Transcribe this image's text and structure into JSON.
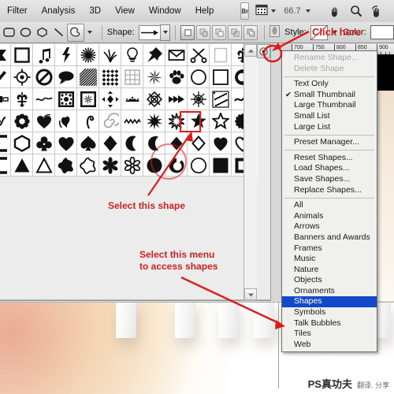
{
  "menubar": {
    "items": [
      "Filter",
      "Analysis",
      "3D",
      "View",
      "Window",
      "Help"
    ],
    "bridge_label": "Br",
    "zoom_value": "66.7",
    "icons": [
      "bridge-icon",
      "view-extras-icon",
      "hand-tool-icon",
      "zoom-tool-icon",
      "rotate-view-icon",
      "screen-mode-icon"
    ]
  },
  "options_bar": {
    "shape_label": "Shape:",
    "style_label": "Style:",
    "color_label": "Color:",
    "color_value": "#ffffff",
    "tools": [
      "rounded-rectangle-tool",
      "ellipse-tool",
      "polygon-tool",
      "line-tool",
      "custom-shape-tool"
    ],
    "mode_buttons": [
      "shape-layers-mode",
      "add-to-shape-area",
      "subtract-from-shape-area",
      "intersect-shape-areas",
      "exclude-overlapping-areas"
    ]
  },
  "ruler": {
    "labels": [
      "700",
      "750",
      "800",
      "850",
      "900"
    ]
  },
  "shape_picker": {
    "rows": [
      [
        "flag-banner",
        "square-frame",
        "eighth-notes",
        "lightning-bolt",
        "starburst-spiky",
        "grass-tuft",
        "light-bulb",
        "push-pin",
        "envelope",
        "scissors",
        "blank-photo",
        "fleur-de-lis"
      ],
      [
        "brush-stroke",
        "target-crosshair",
        "no-entry-sign",
        "speech-bubble",
        "diagonal-hatch",
        "dot-grid-diamonds",
        "square-grid",
        "star-burst-8",
        "paw-print",
        "circle-outline",
        "square-outline",
        "copyright-c"
      ],
      [
        "rectangle-tab",
        "fleur-de-lis-2",
        "flourish-swirl",
        "ornate-tile-square",
        "ornate-tile-square-2",
        "four-way-arrow-diamond",
        "crown-ornament",
        "diamond-knot",
        "arrow-feather",
        "snowflake-ornate",
        "damask-tile",
        "double-swirl"
      ],
      [
        "ribbon-knot",
        "flower-rosette",
        "heart-vine",
        "heart-leaf-swirl",
        "curled-vine",
        "spiral",
        "zigzag-line",
        "star-burst-10",
        "star-burst-jagged",
        "star-5-filled",
        "star-5-outline",
        "blob-circle"
      ],
      [
        "rounded-square-open",
        "hexagon-outline",
        "club-suit",
        "heart-suit",
        "spade-suit",
        "diamond-suit",
        "crescent-moon",
        "crescent-moon-2",
        "diamond-small",
        "diamond-outline",
        "heart-filled",
        "heart-outline"
      ],
      [
        "square-frame-open",
        "triangle-filled",
        "triangle-outline",
        "star-blob-4",
        "star-blob-outline",
        "asterisk-6",
        "flower-6-outline",
        "circle-filled",
        "circle-ring",
        "circle-outline-2",
        "square-filled",
        "square-in-square"
      ]
    ],
    "selected_shape": "star-5-filled",
    "selected_row": 3,
    "selected_col": 9
  },
  "flyout_menu": {
    "groups": [
      [
        {
          "label": "Rename Shape...",
          "state": "disabled"
        },
        {
          "label": "Delete Shape",
          "state": "disabled"
        }
      ],
      [
        {
          "label": "Text Only",
          "state": "normal"
        },
        {
          "label": "Small Thumbnail",
          "state": "checked"
        },
        {
          "label": "Large Thumbnail",
          "state": "normal"
        },
        {
          "label": "Small List",
          "state": "normal"
        },
        {
          "label": "Large List",
          "state": "normal"
        }
      ],
      [
        {
          "label": "Preset Manager...",
          "state": "normal"
        }
      ],
      [
        {
          "label": "Reset Shapes...",
          "state": "normal"
        },
        {
          "label": "Load Shapes...",
          "state": "normal"
        },
        {
          "label": "Save Shapes...",
          "state": "normal"
        },
        {
          "label": "Replace Shapes...",
          "state": "normal"
        }
      ],
      [
        {
          "label": "All",
          "state": "normal"
        },
        {
          "label": "Animals",
          "state": "normal"
        },
        {
          "label": "Arrows",
          "state": "normal"
        },
        {
          "label": "Banners and Awards",
          "state": "normal"
        },
        {
          "label": "Frames",
          "state": "normal"
        },
        {
          "label": "Music",
          "state": "normal"
        },
        {
          "label": "Nature",
          "state": "normal"
        },
        {
          "label": "Objects",
          "state": "normal"
        },
        {
          "label": "Ornaments",
          "state": "normal"
        },
        {
          "label": "Shapes",
          "state": "highlighted"
        },
        {
          "label": "Symbols",
          "state": "normal"
        },
        {
          "label": "Talk Bubbles",
          "state": "normal"
        },
        {
          "label": "Tiles",
          "state": "normal"
        },
        {
          "label": "Web",
          "state": "normal"
        }
      ]
    ],
    "checkmark": "✔",
    "highlight_color": "#1149c8"
  },
  "annotations": {
    "click_here": "Click here",
    "select_shape": "Select this shape",
    "select_menu_line1": "Select this menu",
    "select_menu_line2": "to access shapes",
    "color": "#cc2222"
  },
  "watermark": {
    "main": "PS真功夫",
    "sub": "翻译. 分享"
  }
}
